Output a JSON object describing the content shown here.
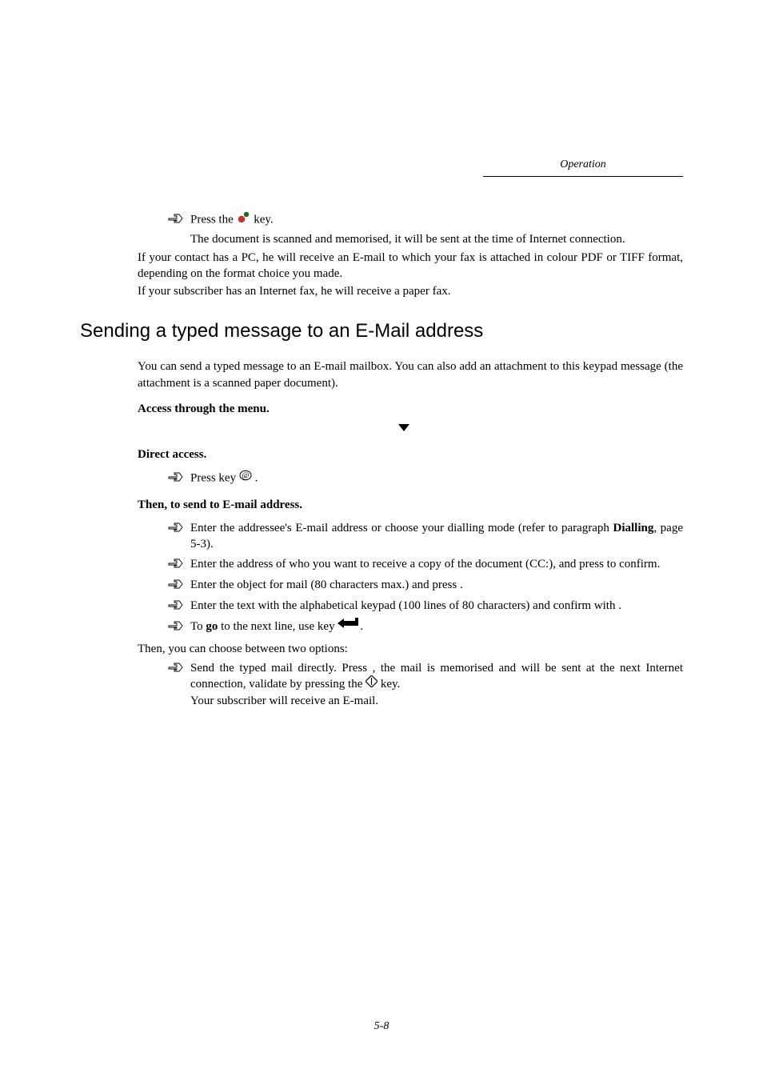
{
  "header": {
    "section": "Operation"
  },
  "intro": {
    "step_press_prefix": "Press the ",
    "step_press_suffix": " key.",
    "memorised": "The document is scanned and memorised, it will be sent at the time of Internet connection.",
    "pc_contact": "If your contact has a PC, he will receive an E-mail to which your fax is attached in colour PDF or TIFF format, depending on the format choice you made.",
    "internet_fax": "If your subscriber has an Internet fax, he will receive a paper fax."
  },
  "section": {
    "title": "Sending a typed message to an E-Mail address",
    "intro": "You can send a typed message to an E-mail mailbox. You can also add an attachment to this keypad message (the attachment is a scanned paper document).",
    "access_menu": "Access through the menu.",
    "direct_access": "Direct access.",
    "press_key_prefix": "Press key ",
    "press_key_suffix": " .",
    "then_send": "Then, to send to E-mail address.",
    "step_addressee_pre": "Enter the addressee's E-mail address or choose your dialling mode (refer to paragraph ",
    "step_addressee_bold": "Dialling",
    "step_addressee_post": ", page 5-3).",
    "step_cc": "Enter the address of who you want to receive a copy of the document (CC:), and press       to confirm.",
    "step_object": "Enter the object for mail (80 characters max.) and press      .",
    "step_text": "Enter the text with the alphabetical keypad (100 lines of 80 characters) and confirm with       .",
    "step_go_pre": "To ",
    "step_go_bold": "go",
    "step_go_mid": " to the next line, use key ",
    "step_go_post": ".",
    "then_options": "Then, you can choose between two options:",
    "step_send_a": "Send the typed mail directly. Press     , the mail is memorised and will be sent at the next Internet connection,  validate by pressing the  ",
    "step_send_b": "  key.",
    "step_send_c": "Your subscriber will receive an E-mail."
  },
  "footer": {
    "page": "5-8"
  }
}
